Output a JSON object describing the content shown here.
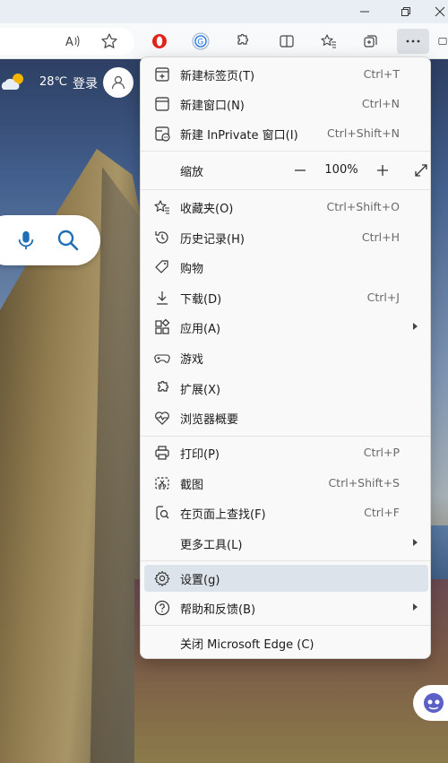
{
  "weather": {
    "temp": "28℃"
  },
  "header": {
    "login_label": "登录"
  },
  "menu": {
    "items": [
      {
        "label": "新建标签页(T)",
        "shortcut": "Ctrl+T"
      },
      {
        "label": "新建窗口(N)",
        "shortcut": "Ctrl+N"
      },
      {
        "label": "新建 InPrivate 窗口(I)",
        "shortcut": "Ctrl+Shift+N"
      },
      {
        "label": "缩放",
        "zoom_value": "100%"
      },
      {
        "label": "收藏夹(O)",
        "shortcut": "Ctrl+Shift+O"
      },
      {
        "label": "历史记录(H)",
        "shortcut": "Ctrl+H"
      },
      {
        "label": "购物"
      },
      {
        "label": "下载(D)",
        "shortcut": "Ctrl+J"
      },
      {
        "label": "应用(A)"
      },
      {
        "label": "游戏"
      },
      {
        "label": "扩展(X)"
      },
      {
        "label": "浏览器概要"
      },
      {
        "label": "打印(P)",
        "shortcut": "Ctrl+P"
      },
      {
        "label": "截图",
        "shortcut": "Ctrl+Shift+S"
      },
      {
        "label": "在页面上查找(F)",
        "shortcut": "Ctrl+F"
      },
      {
        "label": "更多工具(L)"
      },
      {
        "label": "设置(g)"
      },
      {
        "label": "帮助和反馈(B)"
      },
      {
        "label": "关闭 Microsoft Edge (C)"
      }
    ],
    "hovered_item": "设置(g)"
  },
  "icons": {
    "toolbar": [
      "read-aloud-icon",
      "favorite-star-icon",
      "opera-icon",
      "grammarly-icon",
      "extensions-icon",
      "split-screen-icon",
      "favorites-icon",
      "collections-icon",
      "more-icon"
    ],
    "menu": [
      "new-tab-icon",
      "new-window-icon",
      "inprivate-icon",
      "zoom-out-icon",
      "zoom-in-icon",
      "fullscreen-icon",
      "favorites-icon",
      "history-icon",
      "shopping-icon",
      "download-icon",
      "apps-icon",
      "games-icon",
      "extensions-icon",
      "browser-essentials-icon",
      "print-icon",
      "screenshot-icon",
      "find-icon",
      "settings-icon",
      "help-icon"
    ]
  },
  "colors": {
    "accent": "#0f6cbd",
    "hover": "#dde3ea",
    "menu_bg": "#f9f9f9"
  }
}
